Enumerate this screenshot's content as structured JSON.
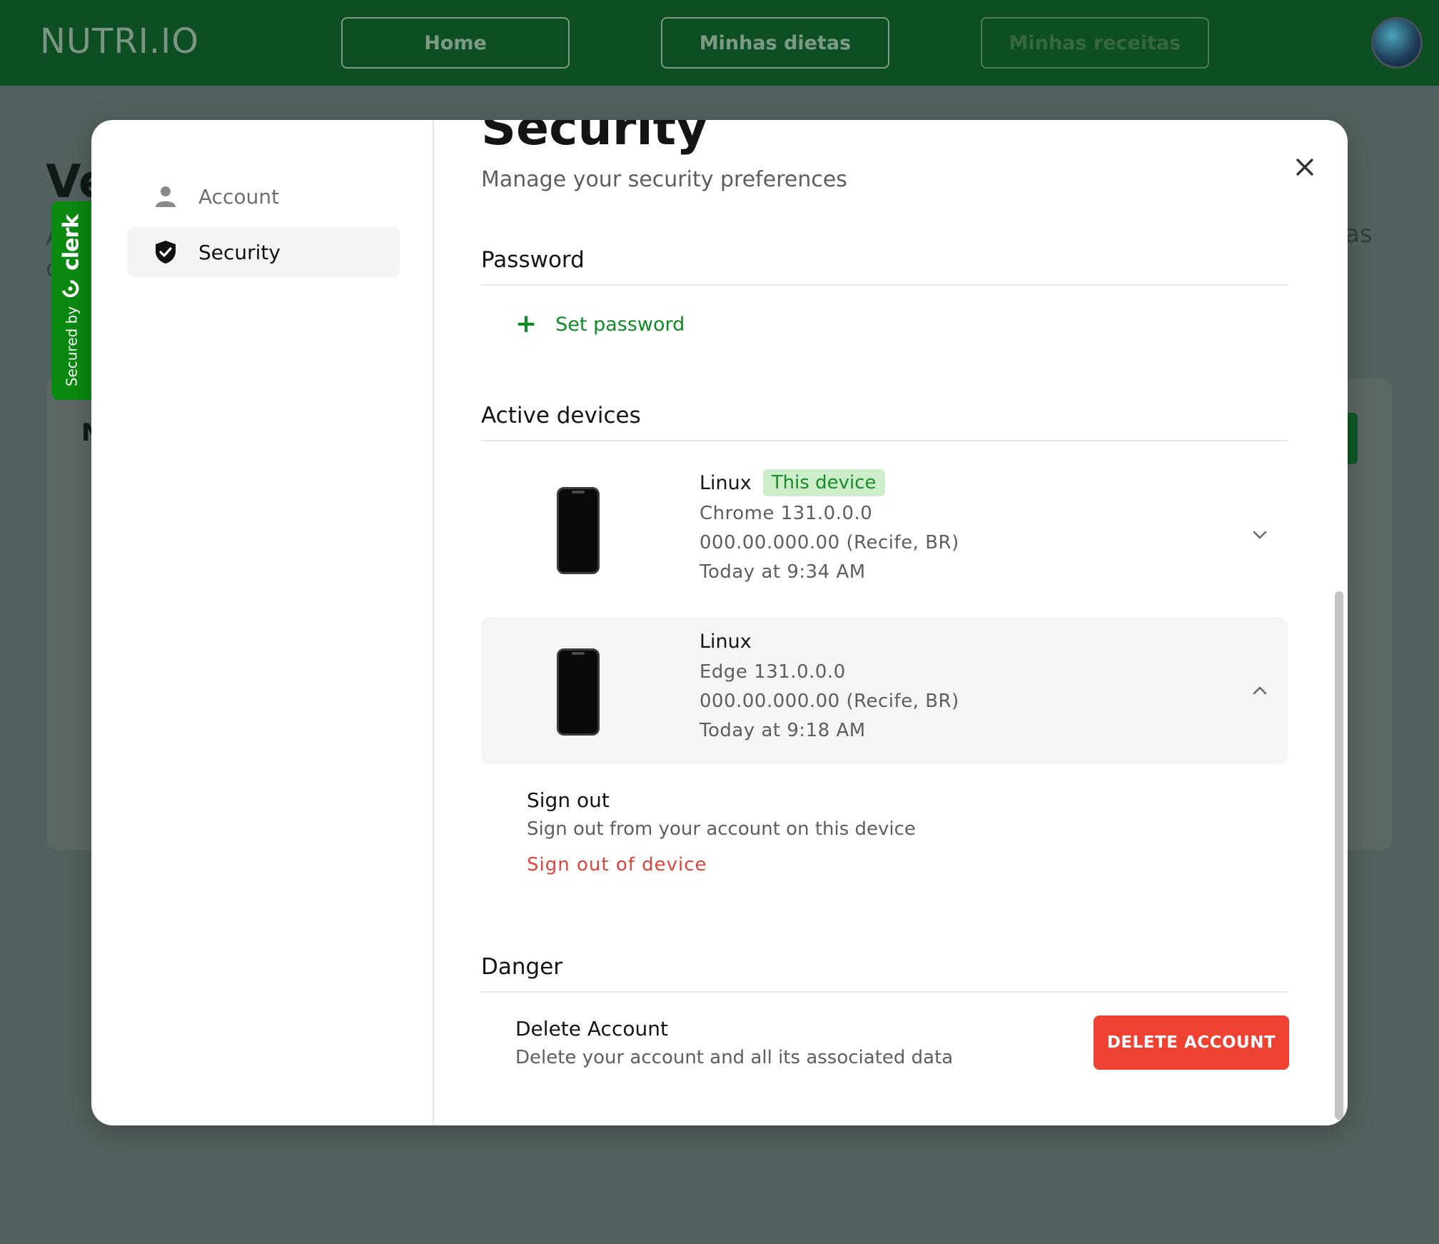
{
  "app": {
    "brand": "NUTRI.IO",
    "nav": [
      "Home",
      "Minhas dietas",
      "Minhas receitas"
    ],
    "bg_fragments": {
      "title": "Ve",
      "right_text": "as",
      "left_a": "A",
      "left_c": "c",
      "left_m": "N"
    }
  },
  "clerk_badge": {
    "secured_by": "Secured by",
    "brand": "clerk"
  },
  "modal": {
    "sidebar": {
      "items": [
        {
          "label": "Account",
          "icon": "user-icon",
          "active": false
        },
        {
          "label": "Security",
          "icon": "shield-check-icon",
          "active": true
        }
      ]
    },
    "title": "Security",
    "subtitle": "Manage your security preferences",
    "password": {
      "title": "Password",
      "action": "Set password"
    },
    "active_devices": {
      "title": "Active devices",
      "devices": [
        {
          "os": "Linux",
          "badge": "This device",
          "browser": "Chrome 131.0.0.0",
          "location": "000.00.000.00 (Recife, BR)",
          "last_active": "Today at 9:34 AM",
          "expanded": false
        },
        {
          "os": "Linux",
          "badge": "",
          "browser": "Edge 131.0.0.0",
          "location": "000.00.000.00 (Recife, BR)",
          "last_active": "Today at 9:18 AM",
          "expanded": true
        }
      ],
      "sign_out": {
        "title": "Sign out",
        "description": "Sign out from your account on this device",
        "link": "Sign out of device"
      }
    },
    "danger": {
      "title": "Danger",
      "delete_title": "Delete Account",
      "delete_description": "Delete your account and all its associated data",
      "delete_button": "DELETE ACCOUNT"
    }
  },
  "colors": {
    "topbar": "#0d4f22",
    "accent_green": "#0f8a25",
    "badge_bg": "#cdeeca",
    "danger_red": "#ef4233",
    "link_red": "#e0433a",
    "clerk_green": "#0b8a10"
  }
}
